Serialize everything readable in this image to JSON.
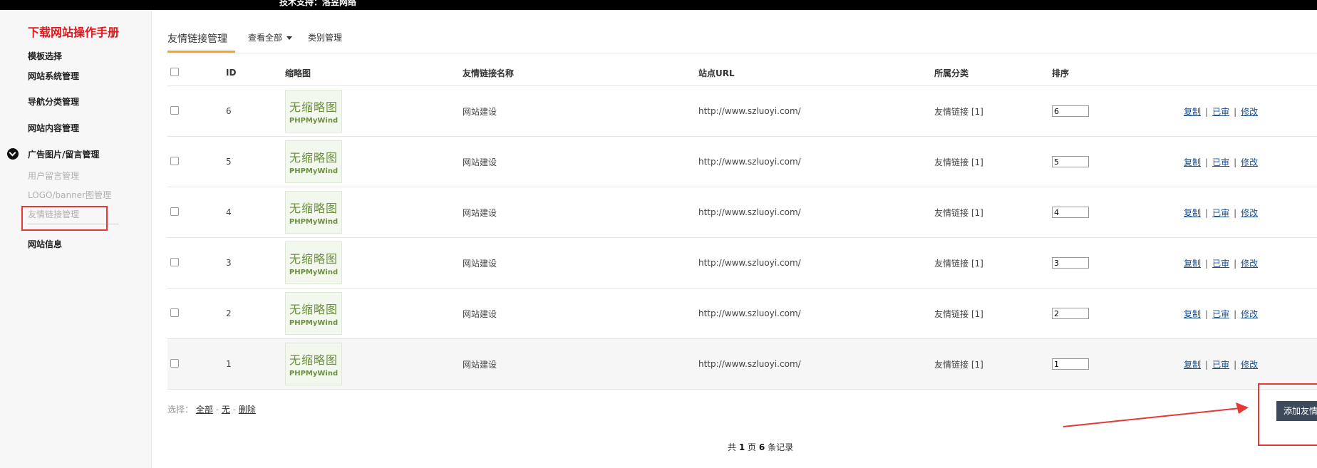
{
  "topbar": {
    "tech_support": "技术支持：洛昱网络"
  },
  "sidebar": {
    "title": "下载网站操作手册",
    "items": [
      {
        "label": "模板选择"
      },
      {
        "label": "网站系统管理"
      },
      {
        "label": "导航分类管理"
      },
      {
        "label": "网站内容管理"
      },
      {
        "label": "广告图片/留言管理"
      },
      {
        "label": "网站信息"
      }
    ],
    "subitems": [
      {
        "label": "用户留言管理"
      },
      {
        "label": "LOGO/banner图管理"
      },
      {
        "label": "友情链接管理"
      }
    ]
  },
  "tabs": {
    "active": "友情链接管理",
    "view_all": "查看全部",
    "category": "类别管理"
  },
  "table": {
    "headers": {
      "id": "ID",
      "thumb": "缩略图",
      "name": "友情链接名称",
      "url": "站点URL",
      "category": "所属分类",
      "order": "排序"
    },
    "thumb_text": {
      "main": "无缩略图",
      "brand": "PHPMyWind"
    },
    "ops": {
      "copy": "复制",
      "audited": "已审",
      "edit": "修改"
    },
    "rows": [
      {
        "id": "6",
        "name": "网站建设",
        "url": "http://www.szluoyi.com/",
        "category": "友情链接 [1]",
        "order": "6"
      },
      {
        "id": "5",
        "name": "网站建设",
        "url": "http://www.szluoyi.com/",
        "category": "友情链接 [1]",
        "order": "5"
      },
      {
        "id": "4",
        "name": "网站建设",
        "url": "http://www.szluoyi.com/",
        "category": "友情链接 [1]",
        "order": "4"
      },
      {
        "id": "3",
        "name": "网站建设",
        "url": "http://www.szluoyi.com/",
        "category": "友情链接 [1]",
        "order": "3"
      },
      {
        "id": "2",
        "name": "网站建设",
        "url": "http://www.szluoyi.com/",
        "category": "友情链接 [1]",
        "order": "2"
      },
      {
        "id": "1",
        "name": "网站建设",
        "url": "http://www.szluoyi.com/",
        "category": "友情链接 [1]",
        "order": "1"
      }
    ]
  },
  "selection": {
    "label": "选择：",
    "all": "全部",
    "none": "无",
    "delete": "删除",
    "dash": "-"
  },
  "pager": {
    "prefix": "共",
    "pages": "1",
    "mid": "页",
    "count": "6",
    "suffix": "条记录"
  },
  "add_button": {
    "label": "添加友情链接"
  },
  "colors": {
    "accent": "#f5a623",
    "brand_red": "#e3161c",
    "annotation_red": "#e53935",
    "button_bg": "#3c4a5c",
    "link": "#1a4f8b"
  }
}
